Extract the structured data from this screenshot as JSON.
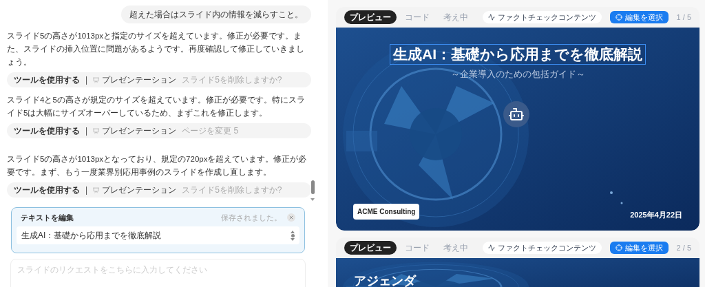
{
  "chat": {
    "messages": [
      {
        "kind": "user",
        "text": "超えた場合はスライド内の情報を減らすこと。"
      },
      {
        "kind": "assistant",
        "text": "スライド5の高さが1013pxと指定のサイズを超えています。修正が必要です。また、スライドの挿入位置に問題があるようです。再度確認して修正していきましょう。"
      },
      {
        "kind": "tool",
        "label": "ツールを使用する",
        "separator": "|",
        "tool": "プレゼンテーション",
        "action": "スライド5を削除しますか?"
      },
      {
        "kind": "assistant",
        "text": "スライド4と5の高さが規定のサイズを超えています。修正が必要です。特にスライド5は大幅にサイズオーバーしているため、まずこれを修正します。"
      },
      {
        "kind": "tool",
        "label": "ツールを使用する",
        "separator": "|",
        "tool": "プレゼンテーション",
        "action": "ページを変更 5"
      },
      {
        "kind": "assistant",
        "text": "スライド5の高さが1013pxとなっており、規定の720pxを超えています。修正が必要です。まず、もう一度業界別応用事例のスライドを作成し直します。"
      },
      {
        "kind": "tool",
        "label": "ツールを使用する",
        "separator": "|",
        "tool": "プレゼンテーション",
        "action": "スライド5を削除しますか?"
      }
    ]
  },
  "edit_panel": {
    "title": "テキストを編集",
    "status": "保存されました。",
    "value": "生成AI：基礎から応用までを徹底解説"
  },
  "request_input": {
    "placeholder": "スライドのリクエストをこちらに入力してください"
  },
  "previews": [
    {
      "tabs": [
        {
          "label": "プレビュー",
          "selected": true
        },
        {
          "label": "コード",
          "selected": false
        },
        {
          "label": "考え中",
          "selected": false
        }
      ],
      "fact_check": "ファクトチェックコンテンツ",
      "edit_button": "編集を選択",
      "page": "1 / 5",
      "slide": {
        "kind": "cover",
        "title": "生成AI：基礎から応用までを徹底解説",
        "title_selected": true,
        "subtitle": "～企業導入のための包括ガイド～",
        "company": "ACME Consulting",
        "date": "2025年4月22日"
      }
    },
    {
      "tabs": [
        {
          "label": "プレビュー",
          "selected": true
        },
        {
          "label": "コード",
          "selected": false
        },
        {
          "label": "考え中",
          "selected": false
        }
      ],
      "fact_check": "ファクトチェックコンテンツ",
      "edit_button": "編集を選択",
      "page": "2 / 5",
      "slide": {
        "kind": "agenda",
        "title": "アジェンダ",
        "title_selected": false
      }
    }
  ]
}
